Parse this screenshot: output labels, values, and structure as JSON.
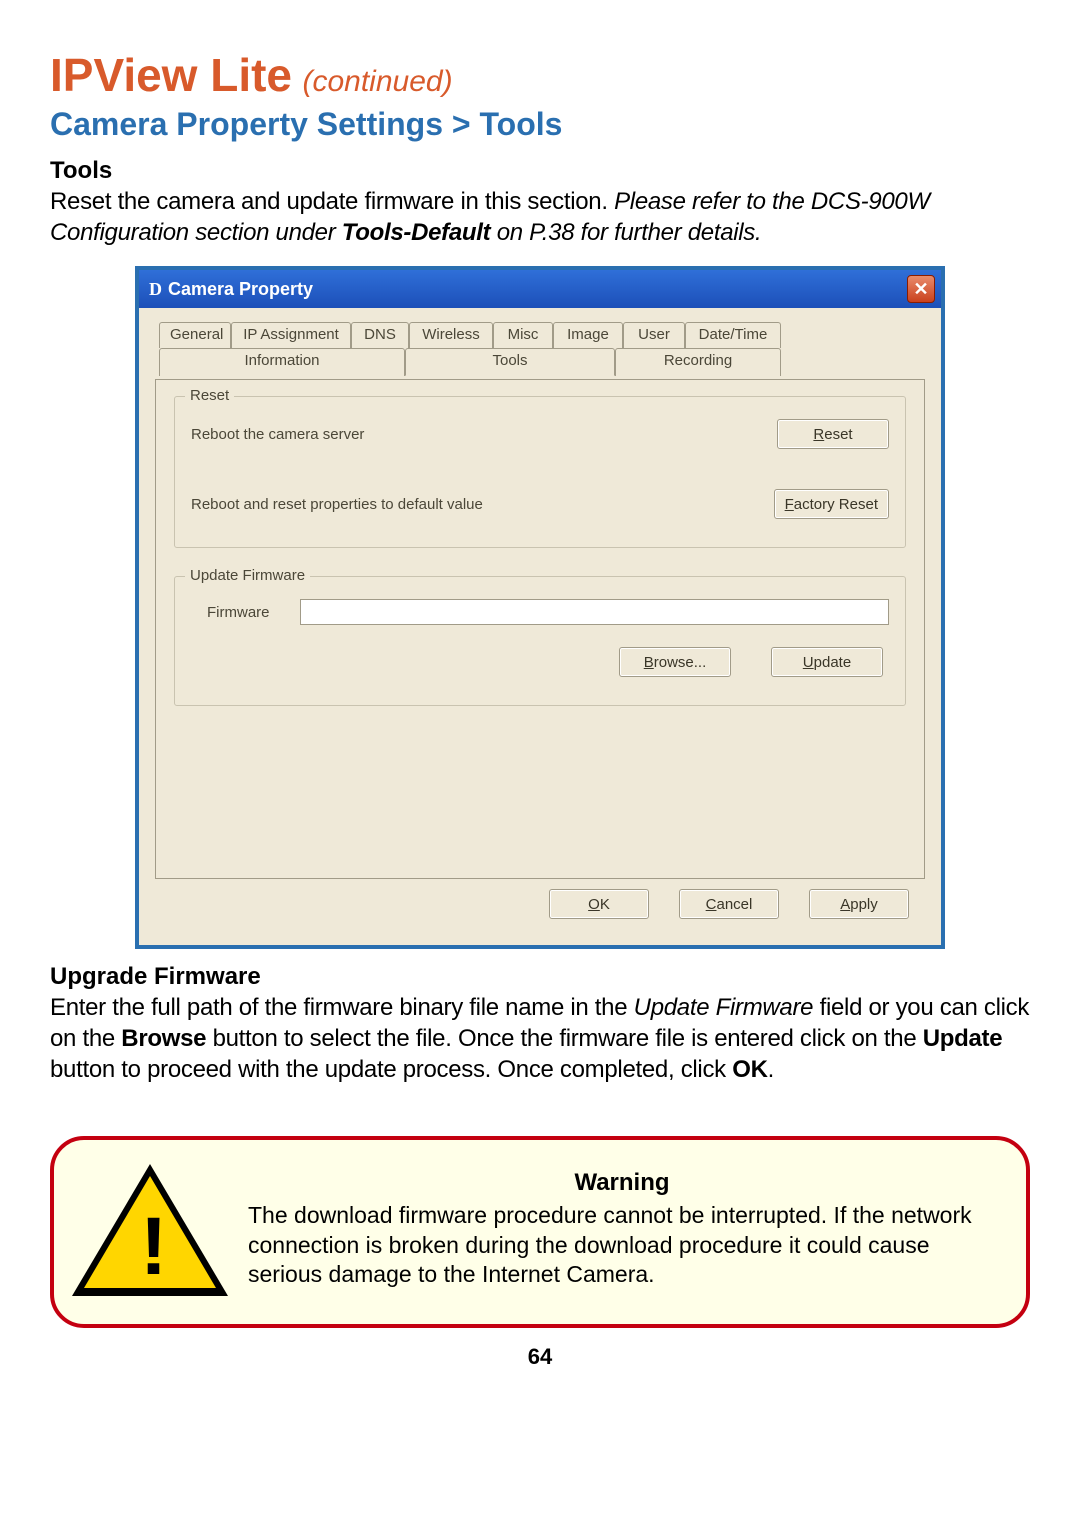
{
  "header": {
    "title_main": "IPView Lite",
    "title_sub": "(continued)",
    "breadcrumb": "Camera Property Settings > Tools"
  },
  "tools": {
    "label": "Tools",
    "intro_plain": "Reset the camera and update firmware in this section. ",
    "intro_italic_1": "Please refer to the DCS-900W Configuration section under ",
    "intro_bolditalic": "Tools-Default",
    "intro_italic_2": " on P.38 for further details."
  },
  "dialog": {
    "title": "Camera Property",
    "tabs_row1": [
      "General",
      "IP Assignment",
      "DNS",
      "Wireless",
      "Misc",
      "Image",
      "User",
      "Date/Time"
    ],
    "tabs_row2": [
      "Information",
      "Tools",
      "Recording"
    ],
    "active_tab": "Tools",
    "reset_group": {
      "legend": "Reset",
      "reboot_label": "Reboot the camera server",
      "reset_btn": "Reset",
      "factory_label": "Reboot and reset properties to default value",
      "factory_btn": "Factory Reset"
    },
    "firmware_group": {
      "legend": "Update Firmware",
      "path_label": "Firmware",
      "browse_btn": "Browse...",
      "update_btn": "Update"
    },
    "buttons": {
      "ok": "OK",
      "cancel": "Cancel",
      "apply": "Apply"
    }
  },
  "upgrade": {
    "label": "Upgrade Firmware",
    "line1a": "Enter the full path of the firmware binary file name in the ",
    "line1b_i": "Update Firmware",
    "line1c": " field or you can click on the ",
    "line1d_b": "Browse",
    "line1e": " button to select the file. Once the firmware file is entered click on the ",
    "line1f_b": "Update",
    "line1g": " button to proceed with the update process. Once completed, click ",
    "line1h_b": "OK",
    "line1i": "."
  },
  "warning": {
    "heading": "Warning",
    "text": "The download firmware procedure cannot be interrupted. If the network connection is broken during the download procedure it could cause serious damage to the Internet Camera."
  },
  "page_number": "64"
}
